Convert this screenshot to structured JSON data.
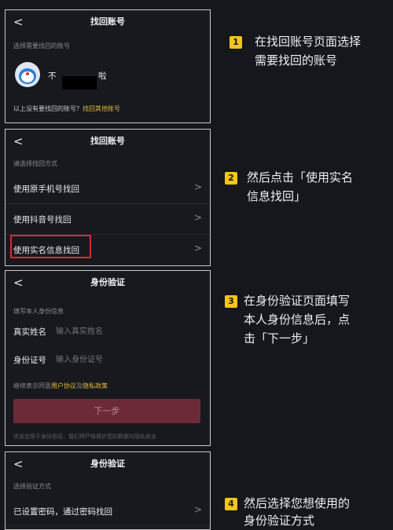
{
  "panel1": {
    "back": "<",
    "title": "找回账号",
    "subtitle": "选择需要找回的账号",
    "account_prefix": "不",
    "account_suffix": "啦",
    "footer_text": "以上没有要找回的账号？",
    "footer_link": "找回其他账号"
  },
  "panel2": {
    "back": "<",
    "title": "找回账号",
    "subtitle": "请选择找回方式",
    "options": [
      {
        "label": "使用原手机号找回",
        "chev": ">"
      },
      {
        "label": "使用抖音号找回",
        "chev": ">"
      },
      {
        "label": "使用实名信息找回",
        "chev": ">"
      }
    ]
  },
  "panel3": {
    "back": "<",
    "title": "身份验证",
    "subtitle": "填写本人身份信息",
    "name_label": "真实姓名",
    "name_placeholder": "输入真实姓名",
    "id_label": "身份证号",
    "id_placeholder": "输入身份证号",
    "agree_prefix": "继续表示同意",
    "agree_link1": "用户协议",
    "agree_and": "及",
    "agree_link2": "隐私政策",
    "next_button": "下一步",
    "note": "信息仅用于身份验证，我们将严格保护您的数据与隐私安全"
  },
  "panel4": {
    "back": "<",
    "title": "身份验证",
    "subtitle": "选择验证方式",
    "option": "已设置密码，通过密码找回",
    "chev": ">"
  },
  "steps": [
    {
      "num": "1",
      "line1": "在找回账号页面选择",
      "line2": "需要找回的账号"
    },
    {
      "num": "2",
      "line1": "然后点击「使用实名",
      "line2": "信息找回」"
    },
    {
      "num": "3",
      "line1": "在身份验证页面填写",
      "line2": "本人身份信息后，点",
      "line3": "击「下一步」"
    },
    {
      "num": "4",
      "line1": "然后选择您想使用的",
      "line2": "身份验证方式"
    }
  ],
  "colors": {
    "background": "#16171c",
    "badge": "#f5c519",
    "link": "#e4ba3a",
    "highlight_border": "#e0262e",
    "next_button": "#6b2a36"
  }
}
